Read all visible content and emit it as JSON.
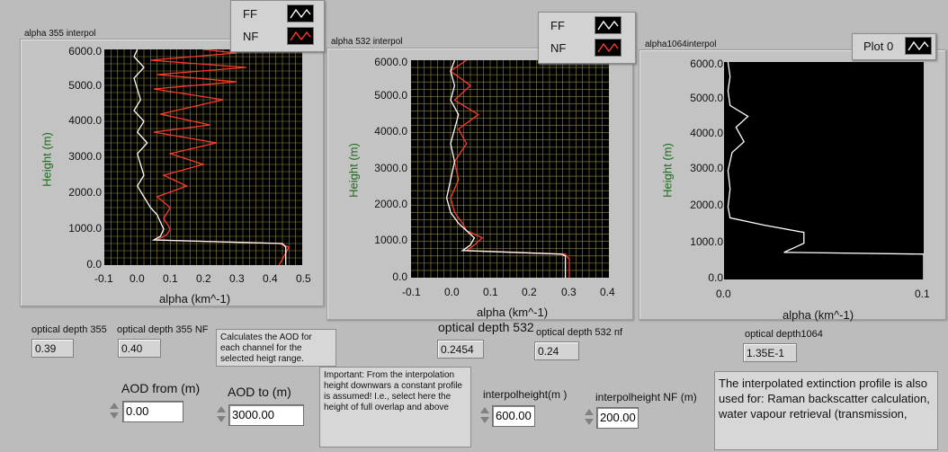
{
  "graphs": [
    {
      "title": "alpha 355 interpol",
      "xlabel": "alpha (km^-1)",
      "ylabel": "Height (m)",
      "yticks": [
        "6000.0",
        "5000.0",
        "4000.0",
        "3000.0",
        "2000.0",
        "1000.0",
        "0.0"
      ],
      "xticks": [
        "-0.1",
        "0.0",
        "0.1",
        "0.2",
        "0.3",
        "0.4",
        "0.5"
      ],
      "legend": [
        {
          "name": "FF",
          "color": "#ffffff"
        },
        {
          "name": "NF",
          "color": "#ff3a2a"
        }
      ]
    },
    {
      "title": "alpha 532 interpol",
      "xlabel": "alpha (km^-1)",
      "ylabel": "Height (m)",
      "yticks": [
        "6000.0",
        "5000.0",
        "4000.0",
        "3000.0",
        "2000.0",
        "1000.0",
        "0.0"
      ],
      "xticks": [
        "-0.1",
        "0.0",
        "0.1",
        "0.2",
        "0.3",
        "0.4"
      ],
      "legend": [
        {
          "name": "FF",
          "color": "#ffffff"
        },
        {
          "name": "NF",
          "color": "#ff3a2a"
        }
      ]
    },
    {
      "title": "alpha1064interpol",
      "xlabel": "alpha (km^-1)",
      "ylabel": "Height (m)",
      "yticks": [
        "6000.0",
        "5000.0",
        "4000.0",
        "3000.0",
        "2000.0",
        "1000.0",
        "0.0"
      ],
      "xticks": [
        "0.0",
        "0.1"
      ],
      "legend": [
        {
          "name": "Plot 0",
          "color": "#ffffff"
        }
      ]
    }
  ],
  "indicators": {
    "od355": {
      "label": "optical depth 355",
      "value": "0.39"
    },
    "od355nf": {
      "label": "optical depth 355 NF",
      "value": "0.40"
    },
    "od532": {
      "label": "optical depth 532",
      "value": "0.2454"
    },
    "od532nf": {
      "label": "optical depth 532 nf",
      "value": "0.24"
    },
    "od1064": {
      "label": "optical depth1064",
      "value": "1.35E-1"
    }
  },
  "controls": {
    "aod_from": {
      "label": "AOD from (m)",
      "value": "0.00"
    },
    "aod_to": {
      "label": "AOD to (m)",
      "value": "3000.00"
    },
    "interpol": {
      "label": "interpolheight(m )",
      "value": "600.00"
    },
    "interpol_nf": {
      "label": "interpolheight NF (m)",
      "value": "200.00"
    }
  },
  "notes": {
    "aod": "Calculates the AOD for each channel for the selected heigt range.",
    "important": "Important: From the interpolation height downwars a constant  profile is assumed! I.e., select here the height of full overlap and above",
    "extinction": "The interpolated extinction profile is also used for: Raman backscatter calculation, water vapour retrieval (transmission,"
  },
  "colors": {
    "plot_bg": "#000000",
    "grid": "#8f8a45",
    "ff_trace": "#ffffff",
    "nf_trace": "#ff3a2a",
    "ylabel_color": "#1c6b1c"
  },
  "chart_data": [
    {
      "type": "line",
      "title": "alpha 355 interpol",
      "xlabel": "alpha (km^-1)",
      "ylabel": "Height (m)",
      "xlim": [
        -0.1,
        0.5
      ],
      "ylim": [
        0,
        6000
      ],
      "grid": true,
      "series": [
        {
          "name": "FF",
          "points": [
            [
              0.45,
              0
            ],
            [
              0.45,
              500
            ],
            [
              0.44,
              600
            ],
            [
              0.05,
              700
            ],
            [
              0.07,
              800
            ],
            [
              0.08,
              1000
            ],
            [
              0.07,
              1200
            ],
            [
              0.06,
              1400
            ],
            [
              0.04,
              1600
            ],
            [
              0.02,
              1900
            ],
            [
              0.0,
              2200
            ],
            [
              0.02,
              2500
            ],
            [
              0.01,
              2800
            ],
            [
              0.0,
              3100
            ],
            [
              0.03,
              3400
            ],
            [
              0.0,
              3700
            ],
            [
              0.02,
              4000
            ],
            [
              -0.01,
              4300
            ],
            [
              0.01,
              4600
            ],
            [
              0.0,
              4900
            ],
            [
              -0.01,
              5200
            ],
            [
              0.02,
              5500
            ],
            [
              -0.01,
              5800
            ],
            [
              0.0,
              6000
            ]
          ]
        },
        {
          "name": "NF",
          "points": [
            [
              0.43,
              0
            ],
            [
              0.46,
              500
            ],
            [
              0.43,
              600
            ],
            [
              0.06,
              700
            ],
            [
              0.09,
              850
            ],
            [
              0.1,
              1000
            ],
            [
              0.08,
              1300
            ],
            [
              0.1,
              1600
            ],
            [
              0.06,
              1900
            ],
            [
              0.15,
              2200
            ],
            [
              0.08,
              2500
            ],
            [
              0.2,
              2800
            ],
            [
              0.1,
              3100
            ],
            [
              0.24,
              3400
            ],
            [
              0.05,
              3700
            ],
            [
              0.22,
              3900
            ],
            [
              0.07,
              4200
            ],
            [
              0.26,
              4600
            ],
            [
              0.05,
              4900
            ],
            [
              0.3,
              5100
            ],
            [
              0.06,
              5300
            ],
            [
              0.33,
              5500
            ],
            [
              0.04,
              5700
            ],
            [
              0.3,
              5900
            ],
            [
              0.2,
              6000
            ]
          ]
        }
      ]
    },
    {
      "type": "line",
      "title": "alpha 532 interpol",
      "xlabel": "alpha (km^-1)",
      "ylabel": "Height (m)",
      "xlim": [
        -0.1,
        0.4
      ],
      "ylim": [
        0,
        6000
      ],
      "grid": true,
      "series": [
        {
          "name": "FF",
          "points": [
            [
              0.29,
              0
            ],
            [
              0.29,
              600
            ],
            [
              0.28,
              650
            ],
            [
              0.03,
              750
            ],
            [
              0.05,
              900
            ],
            [
              0.06,
              1100
            ],
            [
              0.04,
              1300
            ],
            [
              0.02,
              1500
            ],
            [
              0.0,
              1800
            ],
            [
              -0.01,
              2200
            ],
            [
              0.0,
              2700
            ],
            [
              0.01,
              3200
            ],
            [
              0.0,
              3700
            ],
            [
              0.01,
              4100
            ],
            [
              0.02,
              4500
            ],
            [
              0.0,
              4900
            ],
            [
              0.01,
              5300
            ],
            [
              0.0,
              5700
            ],
            [
              0.01,
              6000
            ]
          ]
        },
        {
          "name": "NF",
          "points": [
            [
              0.3,
              0
            ],
            [
              0.3,
              500
            ],
            [
              0.29,
              650
            ],
            [
              0.04,
              750
            ],
            [
              0.06,
              900
            ],
            [
              0.08,
              1100
            ],
            [
              0.04,
              1300
            ],
            [
              0.03,
              1500
            ],
            [
              0.01,
              1800
            ],
            [
              0.0,
              2200
            ],
            [
              0.02,
              2700
            ],
            [
              0.01,
              3200
            ],
            [
              0.04,
              3700
            ],
            [
              0.02,
              4100
            ],
            [
              0.07,
              4500
            ],
            [
              0.01,
              4900
            ],
            [
              0.05,
              5300
            ],
            [
              0.0,
              5700
            ],
            [
              0.04,
              6000
            ]
          ]
        }
      ]
    },
    {
      "type": "line",
      "title": "alpha1064interpol",
      "xlabel": "alpha (km^-1)",
      "ylabel": "Height (m)",
      "xlim": [
        0,
        0.1
      ],
      "ylim": [
        0,
        6000
      ],
      "grid": false,
      "series": [
        {
          "name": "Plot 0",
          "points": [
            [
              0.1,
              0
            ],
            [
              0.1,
              700
            ],
            [
              0.03,
              750
            ],
            [
              0.04,
              1000
            ],
            [
              0.04,
              1300
            ],
            [
              0.02,
              1500
            ],
            [
              0.003,
              1700
            ],
            [
              0.002,
              2000
            ],
            [
              0.003,
              2500
            ],
            [
              0.002,
              3000
            ],
            [
              0.004,
              3500
            ],
            [
              0.01,
              3800
            ],
            [
              0.006,
              4200
            ],
            [
              0.012,
              4500
            ],
            [
              0.003,
              4800
            ],
            [
              0.002,
              5200
            ],
            [
              0.003,
              5600
            ],
            [
              0.002,
              6000
            ]
          ]
        }
      ]
    }
  ]
}
